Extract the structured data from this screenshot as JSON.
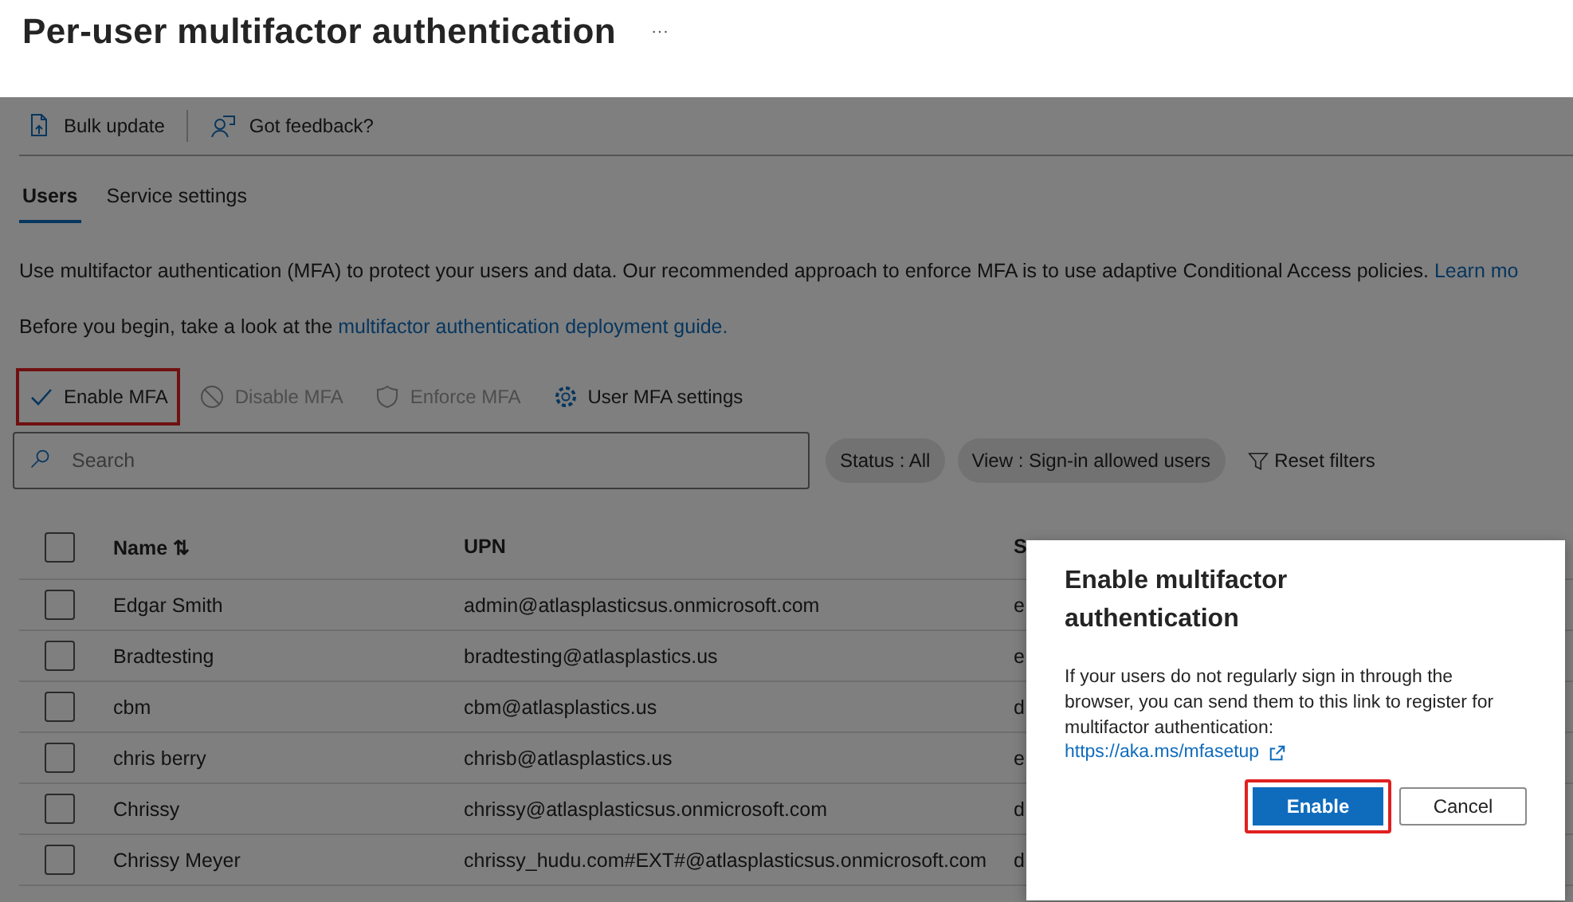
{
  "page": {
    "title": "Per-user multifactor authentication",
    "more": "···"
  },
  "toolbar": [
    {
      "label": "Bulk update",
      "kind": "bulk"
    },
    {
      "label": "Got feedback?",
      "kind": "feedback"
    }
  ],
  "tabs": [
    {
      "label": "Users",
      "selected": true
    },
    {
      "label": "Service settings",
      "selected": false
    }
  ],
  "description": {
    "text": "Use multifactor authentication (MFA) to protect your users and data. Our recommended approach to enforce MFA is to use adaptive Conditional Access policies.",
    "link": "Learn mo"
  },
  "guide": {
    "text": "Before you begin, take a look at the",
    "link": "multifactor authentication deployment guide."
  },
  "commands": [
    {
      "label": "Enable MFA",
      "kind": "check",
      "disabled": false,
      "highlighted": true
    },
    {
      "label": "Disable MFA",
      "kind": "block",
      "disabled": true,
      "highlighted": false
    },
    {
      "label": "Enforce MFA",
      "kind": "shield",
      "disabled": true,
      "highlighted": false
    },
    {
      "label": "User MFA settings",
      "kind": "gear",
      "disabled": false,
      "highlighted": false
    }
  ],
  "search": {
    "placeholder": "Search"
  },
  "filters": [
    {
      "label": "Status : All",
      "kind": "pill"
    },
    {
      "label": "View : Sign-in allowed users",
      "kind": "pill"
    },
    {
      "label": "Reset filters",
      "kind": "reset"
    }
  ],
  "table": {
    "all_checked": false,
    "columns": [
      "Name ⇅",
      "UPN",
      "S"
    ],
    "rows": [
      {
        "checked": false,
        "cells": [
          "Edgar Smith",
          "admin@atlasplasticsus.onmicrosoft.com",
          "e"
        ]
      },
      {
        "checked": false,
        "cells": [
          "Bradtesting",
          "bradtesting@atlasplastics.us",
          "e"
        ]
      },
      {
        "checked": false,
        "cells": [
          "cbm",
          "cbm@atlasplastics.us",
          "d"
        ]
      },
      {
        "checked": false,
        "cells": [
          "chris berry",
          "chrisb@atlasplastics.us",
          "e"
        ]
      },
      {
        "checked": false,
        "cells": [
          "Chrissy",
          "chrissy@atlasplasticsus.onmicrosoft.com",
          "d"
        ]
      },
      {
        "checked": false,
        "cells": [
          "Chrissy Meyer",
          "chrissy_hudu.com#EXT#@atlasplasticsus.onmicrosoft.com",
          "d"
        ]
      }
    ]
  },
  "dialog": {
    "title": "Enable multifactor authentication",
    "body": "If your users do not regularly sign in through the browser, you can send them to this link to register for multifactor authentication:",
    "link": "https://aka.ms/mfasetup",
    "buttons": [
      {
        "label": "Enable",
        "kind": "primary",
        "highlighted": true
      },
      {
        "label": "Cancel",
        "kind": "secondary",
        "highlighted": false
      }
    ]
  }
}
